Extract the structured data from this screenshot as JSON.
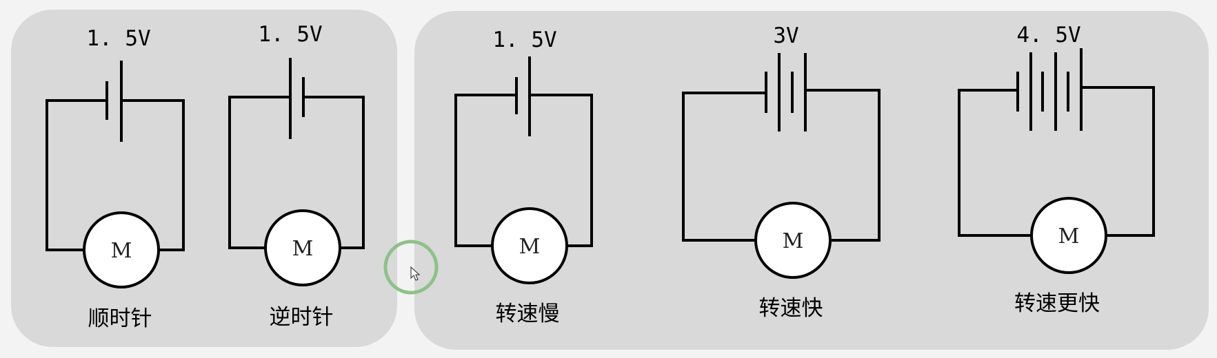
{
  "panels": {
    "left": {
      "circuits": [
        "c1",
        "c2"
      ]
    },
    "right": {
      "circuits": [
        "c3",
        "c4",
        "c5"
      ]
    }
  },
  "circuits": [
    {
      "id": "c1",
      "voltage": "1. 5V",
      "motor": "M",
      "caption": "顺时针",
      "cells": 1,
      "reversed": false
    },
    {
      "id": "c2",
      "voltage": "1. 5V",
      "motor": "M",
      "caption": "逆时针",
      "cells": 1,
      "reversed": true
    },
    {
      "id": "c3",
      "voltage": "1. 5V",
      "motor": "M",
      "caption": "转速慢",
      "cells": 1,
      "reversed": false
    },
    {
      "id": "c4",
      "voltage": "3V",
      "motor": "M",
      "caption": "转速快",
      "cells": 2,
      "reversed": false
    },
    {
      "id": "c5",
      "voltage": "4. 5V",
      "motor": "M",
      "caption": "转速更快",
      "cells": 3,
      "reversed": false
    }
  ],
  "cursor": {
    "icon": "mouse-pointer-icon",
    "highlight_color": "#8fc08a"
  }
}
